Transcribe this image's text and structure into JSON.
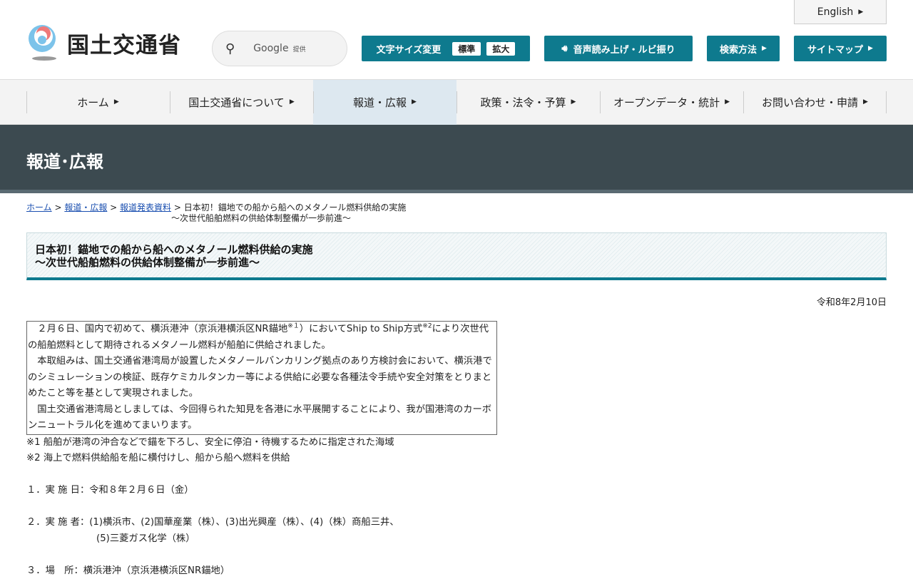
{
  "header": {
    "logo_text": "国土交通省",
    "search": {
      "provider": "Google",
      "provided": "提供"
    },
    "english": "English",
    "font_size": {
      "label": "文字サイズ変更",
      "standard": "標準",
      "large": "拡大"
    },
    "read_aloud": "音声読み上げ・ルビ振り",
    "search_method": "検索方法",
    "sitemap": "サイトマップ"
  },
  "nav": [
    "ホーム",
    "国土交通省について",
    "報道・広報",
    "政策・法令・予算",
    "オープンデータ・統計",
    "お問い合わせ・申請"
  ],
  "banner": "報道･広報",
  "breadcrumb": {
    "home": "ホーム",
    "press": "報道・広報",
    "releases": "報道発表資料",
    "current_1": "日本初！錨地での船から船へのメタノール燃料供給の実施",
    "current_2": "～次世代船舶燃料の供給体制整備が一歩前進～"
  },
  "title": {
    "line1": "日本初！錨地での船から船へのメタノール燃料供給の実施",
    "line2": "～次世代船舶燃料の供給体制整備が一歩前進～"
  },
  "date": "令和8年2月10日",
  "body": {
    "p1a": "２月６日、国内で初めて、横浜港沖（京浜港横浜区NR錨地",
    "p1s1": "※１",
    "p1b": "）においてShip to Ship方式",
    "p1s2": "※2",
    "p1c": "により次世代の船舶燃料として期待されるメタノール燃料が船舶に供給されました。",
    "p2": "本取組みは、国土交通省港湾局が設置したメタノールバンカリング拠点のあり方検討会において、横浜港でのシミュレーションの検証、既存ケミカルタンカー等による供給に必要な各種法令手続や安全対策をとりまとめたこと等を基として実現されました。",
    "p3": "国土交通省港湾局としましては、今回得られた知見を各港に水平展開することにより、我が国港湾のカーボンニュートラル化を進めてまいります。",
    "note1": "※1 船舶が港湾の沖合などで錨を下ろし、安全に停泊・待機するために指定された海域",
    "note2": "※2 海上で燃料供給船を船に横付けし、船から船へ燃料を供給",
    "item1": "１．実 施 日：令和８年２月６日（金）",
    "item2a": "２．実 施 者：(1)横浜市、(2)国華産業（株）、(3)出光興産（株）、(4)（株）商船三井、",
    "item2b": "(5)三菱ガス化学（株）",
    "item3": "３．場　所：横浜港沖（京浜港横浜区NR錨地）"
  }
}
